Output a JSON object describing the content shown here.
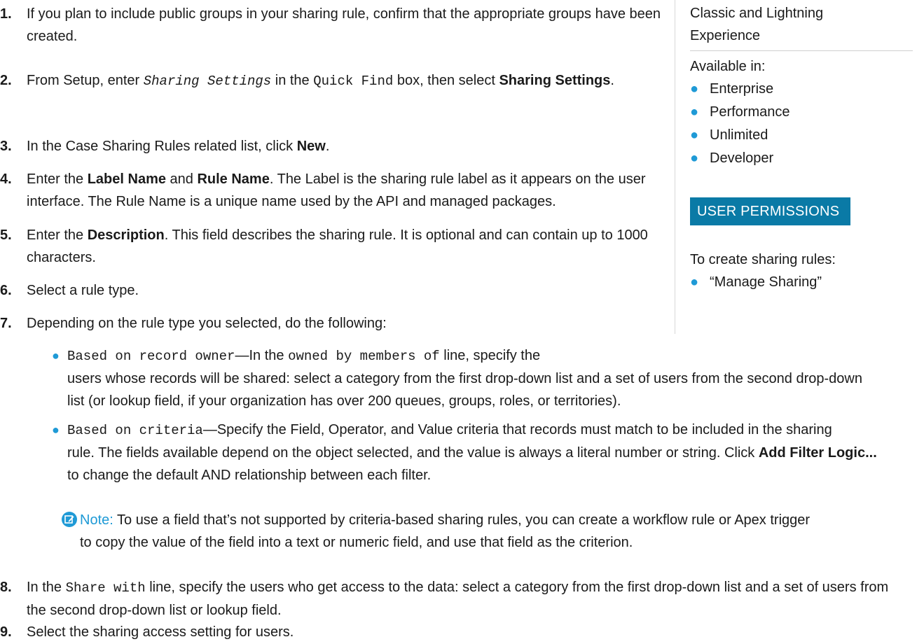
{
  "steps": [
    {
      "num": "1.",
      "parts": [
        "If you plan to include public groups in your sharing rule, confirm that the appropriate groups have been created."
      ]
    },
    {
      "num": "2.",
      "a": "From Setup, enter ",
      "code": "Sharing Settings",
      "b": " in the ",
      "code2": "Quick Find",
      "c": " box, then select ",
      "bold": "Sharing Settings",
      "d": "."
    },
    {
      "num": "3.",
      "a": "In the Case Sharing Rules related list, click ",
      "bold": "New",
      "b": "."
    },
    {
      "num": "4.",
      "a": "Enter the ",
      "bold": "Label Name",
      "b": " and ",
      "bold2": "Rule Name",
      "c": ". The Label is the sharing rule label as it appears on the user interface. The Rule Name is a unique name used by the API and managed packages."
    },
    {
      "num": "5.",
      "a": "Enter the ",
      "bold": "Description",
      "b": ". This field describes the sharing rule. It is optional and can contain up to 1000 characters."
    },
    {
      "num": "6.",
      "a": "Select a rule type."
    },
    {
      "num": "7.",
      "a": "Depending on the rule type you selected, do the following:"
    },
    {
      "num": "8.",
      "a": "In the ",
      "code": "Share with",
      "b": " line, specify the users who get access to the data: select a category from the first drop-down list and a set of users from the second drop-down list or lookup field."
    },
    {
      "num": "9.",
      "a": "Select the sharing access setting for users."
    }
  ],
  "sub_bullets": [
    {
      "code": "Based on record owner",
      "a": "—In the ",
      "code2": "owned by members of",
      "b": " line, specify the",
      "line2": "users whose records will be shared: select a category from the first drop-down list and a set of users from the second drop-down",
      "line3": "list (or lookup field, if your organization has over 200 queues, groups, roles, or territories)."
    },
    {
      "code": "Based on criteria",
      "a": "—Specify the Field, Operator, and Value criteria that records must match to be included in the sharing",
      "line2": "rule. The fields available depend on the object selected, and the value is always a literal number or string. Click ",
      "bold": "Add Filter Logic...",
      "line3": "to change the default AND relationship between each filter."
    }
  ],
  "note": {
    "label": "Note:",
    "line1": " To use a field that’s not supported by criteria-based sharing rules, you can create a workflow rule or Apex trigger",
    "line2": "to copy the value of the field into a text or numeric field, and use that field as the criterion."
  },
  "sidebar": {
    "editions_line1": "Classic and Lightning",
    "editions_line2": "Experience",
    "available_label": "Available in:",
    "editions": [
      "Enterprise",
      "Performance",
      "Unlimited",
      "Developer"
    ],
    "permissions_heading": "USER PERMISSIONS",
    "permission_label": "To create sharing rules:",
    "permissions": [
      "“Manage Sharing”"
    ]
  },
  "colors": {
    "accent": "#1f9ad6",
    "badge": "#0a7aa6"
  }
}
